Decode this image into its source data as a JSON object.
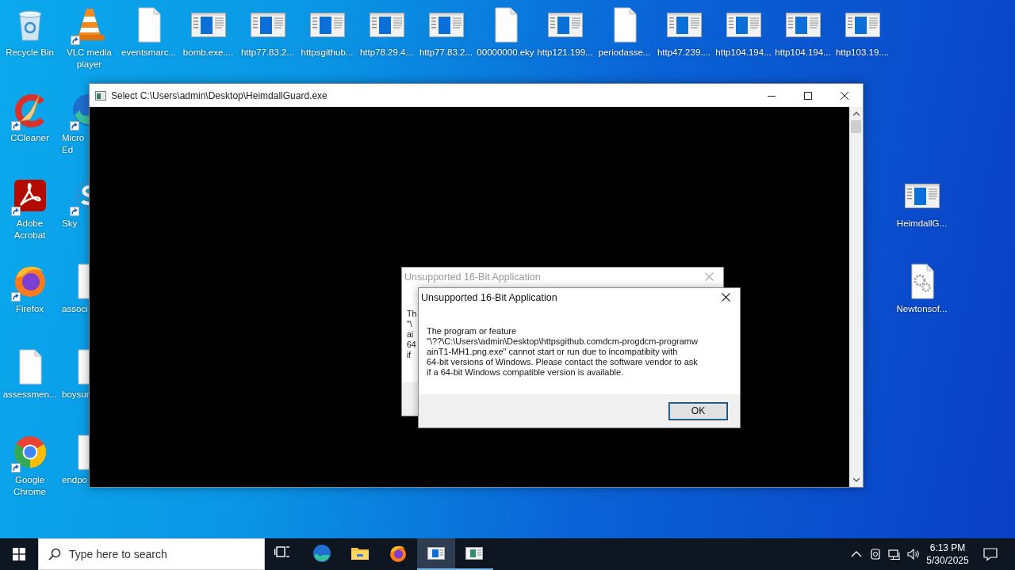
{
  "desktop": {
    "top_row": [
      {
        "label": "Recycle Bin",
        "kind": "recycle",
        "shortcut": false
      },
      {
        "label": "VLC media player",
        "kind": "vlc",
        "shortcut": true
      },
      {
        "label": "eventsmarc...",
        "kind": "file",
        "shortcut": false
      },
      {
        "label": "bomb.exe....",
        "kind": "app",
        "shortcut": false
      },
      {
        "label": "http77.83.2...",
        "kind": "app",
        "shortcut": false
      },
      {
        "label": "httpsgithub...",
        "kind": "app",
        "shortcut": false
      },
      {
        "label": "http78.29.4...",
        "kind": "app",
        "shortcut": false
      },
      {
        "label": "http77.83.2...",
        "kind": "app",
        "shortcut": false
      },
      {
        "label": "00000000.eky",
        "kind": "file",
        "shortcut": false
      },
      {
        "label": "http121.199...",
        "kind": "app",
        "shortcut": false
      },
      {
        "label": "periodasse...",
        "kind": "file",
        "shortcut": false
      },
      {
        "label": "http47.239....",
        "kind": "app",
        "shortcut": false
      },
      {
        "label": "http104.194...",
        "kind": "app",
        "shortcut": false
      },
      {
        "label": "http104.194...",
        "kind": "app",
        "shortcut": false
      },
      {
        "label": "http103.19....",
        "kind": "app",
        "shortcut": false
      }
    ],
    "left_column": [
      {
        "label": "CCleaner",
        "kind": "ccleaner",
        "shortcut": true
      },
      {
        "label": "Adobe Acrobat",
        "kind": "acrobat",
        "shortcut": true
      },
      {
        "label": "Firefox",
        "kind": "firefox",
        "shortcut": true
      },
      {
        "label": "assessmen...",
        "kind": "file",
        "shortcut": false
      },
      {
        "label": "Google Chrome",
        "kind": "chrome",
        "shortcut": true
      }
    ],
    "partly_hidden_column": [
      {
        "label": "Micro Ed",
        "kind": "edge",
        "shortcut": true
      },
      {
        "label": "Sky",
        "kind": "skype",
        "shortcut": true
      },
      {
        "label": "associ",
        "kind": "file",
        "shortcut": false
      },
      {
        "label": "boysur",
        "kind": "file",
        "shortcut": false
      },
      {
        "label": "endpo",
        "kind": "file",
        "shortcut": false
      }
    ],
    "right_column": [
      {
        "label": "HeimdallG...",
        "kind": "app",
        "shortcut": false
      },
      {
        "label": "Newtonsof...",
        "kind": "gears",
        "shortcut": false
      }
    ]
  },
  "console_window": {
    "title": "Select C:\\Users\\admin\\Desktop\\HeimdallGuard.exe",
    "active": true
  },
  "back_dialog": {
    "title": "Unsupported 16-Bit Application",
    "active": false,
    "visible_text": [
      "Th",
      "\"\\",
      "ai",
      "64",
      "if"
    ]
  },
  "front_dialog": {
    "title": "Unsupported 16-Bit Application",
    "active": true,
    "message_lines": [
      "The program or feature",
      "\"\\??\\C:\\Users\\admin\\Desktop\\httpsgithub.comdcm-progdcm-programw",
      "ainT1-MH1.png.exe\" cannot start or run due to incompatibity with",
      "64-bit versions of Windows. Please contact the software vendor to ask",
      "if a 64-bit Windows compatible version is available."
    ],
    "button": "OK"
  },
  "taskbar": {
    "search": {
      "placeholder": "Type here to search"
    },
    "apps": [
      {
        "kind": "taskview",
        "running": false,
        "active": false
      },
      {
        "kind": "edge",
        "running": false,
        "active": false
      },
      {
        "kind": "explorer",
        "running": false,
        "active": false
      },
      {
        "kind": "firefox",
        "running": false,
        "active": false
      },
      {
        "kind": "console",
        "running": true,
        "active": true
      },
      {
        "kind": "app",
        "running": true,
        "active": false
      }
    ],
    "time": "6:13 PM",
    "date": "5/30/2025"
  }
}
